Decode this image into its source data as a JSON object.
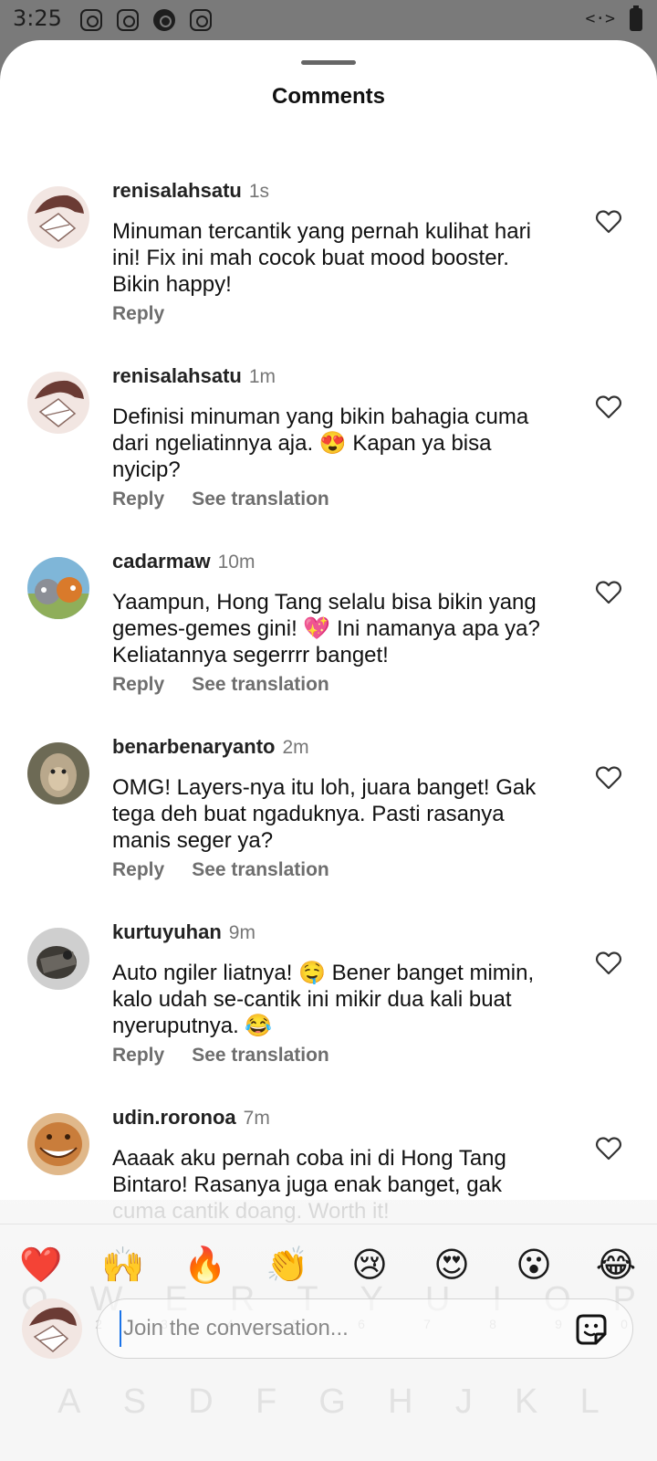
{
  "status_bar": {
    "time": "3:25",
    "right_code": "<·>"
  },
  "sheet": {
    "title": "Comments"
  },
  "comments": [
    {
      "username": "renisalahsatu",
      "time": "1s",
      "text": "Minuman tercantik yang pernah kulihat hari ini! Fix ini mah cocok buat mood booster. Bikin happy!",
      "reply_label": "Reply",
      "translation_label": ""
    },
    {
      "username": "renisalahsatu",
      "time": "1m",
      "text": "Definisi minuman yang bikin bahagia cuma dari ngeliatinnya aja. 😍 Kapan ya bisa nyicip?",
      "reply_label": "Reply",
      "translation_label": "See translation"
    },
    {
      "username": "cadarmaw",
      "time": "10m",
      "text": "Yaampun, Hong Tang selalu bisa bikin yang gemes-gemes gini! 💖 Ini namanya apa ya? Keliatannya segerrrr banget!",
      "reply_label": "Reply",
      "translation_label": "See translation"
    },
    {
      "username": "benarbenaryanto",
      "time": "2m",
      "text": "OMG! Layers-nya itu loh, juara banget! Gak tega deh buat ngaduknya. Pasti rasanya manis seger ya?",
      "reply_label": "Reply",
      "translation_label": "See translation"
    },
    {
      "username": "kurtuyuhan",
      "time": "9m",
      "text": "Auto ngiler liatnya! 🤤 Bener banget mimin, kalo udah se-cantik ini mikir dua kali buat nyeruputnya. 😂",
      "reply_label": "Reply",
      "translation_label": "See translation"
    },
    {
      "username": "udin.roronoa",
      "time": "7m",
      "text": "Aaaak aku pernah coba ini di Hong Tang Bintaro! Rasanya juga enak banget, gak cuma cantik doang. Worth it!",
      "reply_label": "",
      "translation_label": ""
    }
  ],
  "emoji_bar": [
    "❤️",
    "🙌",
    "🔥",
    "👏",
    "😢",
    "😍",
    "😮",
    "😂"
  ],
  "composer": {
    "placeholder": "Join the conversation...",
    "value": ""
  },
  "keyboard_ghost": {
    "numbers": [
      "1",
      "2",
      "3",
      "4",
      "5",
      "6",
      "7",
      "8",
      "9",
      "0"
    ],
    "row1": [
      "Q",
      "W",
      "E",
      "R",
      "T",
      "Y",
      "U",
      "I",
      "O",
      "P"
    ],
    "row2": [
      "A",
      "S",
      "D",
      "F",
      "G",
      "H",
      "J",
      "K",
      "L"
    ]
  },
  "colors": {
    "status_bar_bg": "#7a7a7a",
    "sheet_bg": "#ffffff",
    "secondary_text": "#6e6e6e",
    "cursor": "#1a73e8"
  },
  "icons": {
    "status": [
      "instagram-icon",
      "instagram-icon",
      "threads-icon",
      "instagram-icon"
    ],
    "like": "heart-outline-icon",
    "sticker": "sticker-icon"
  }
}
